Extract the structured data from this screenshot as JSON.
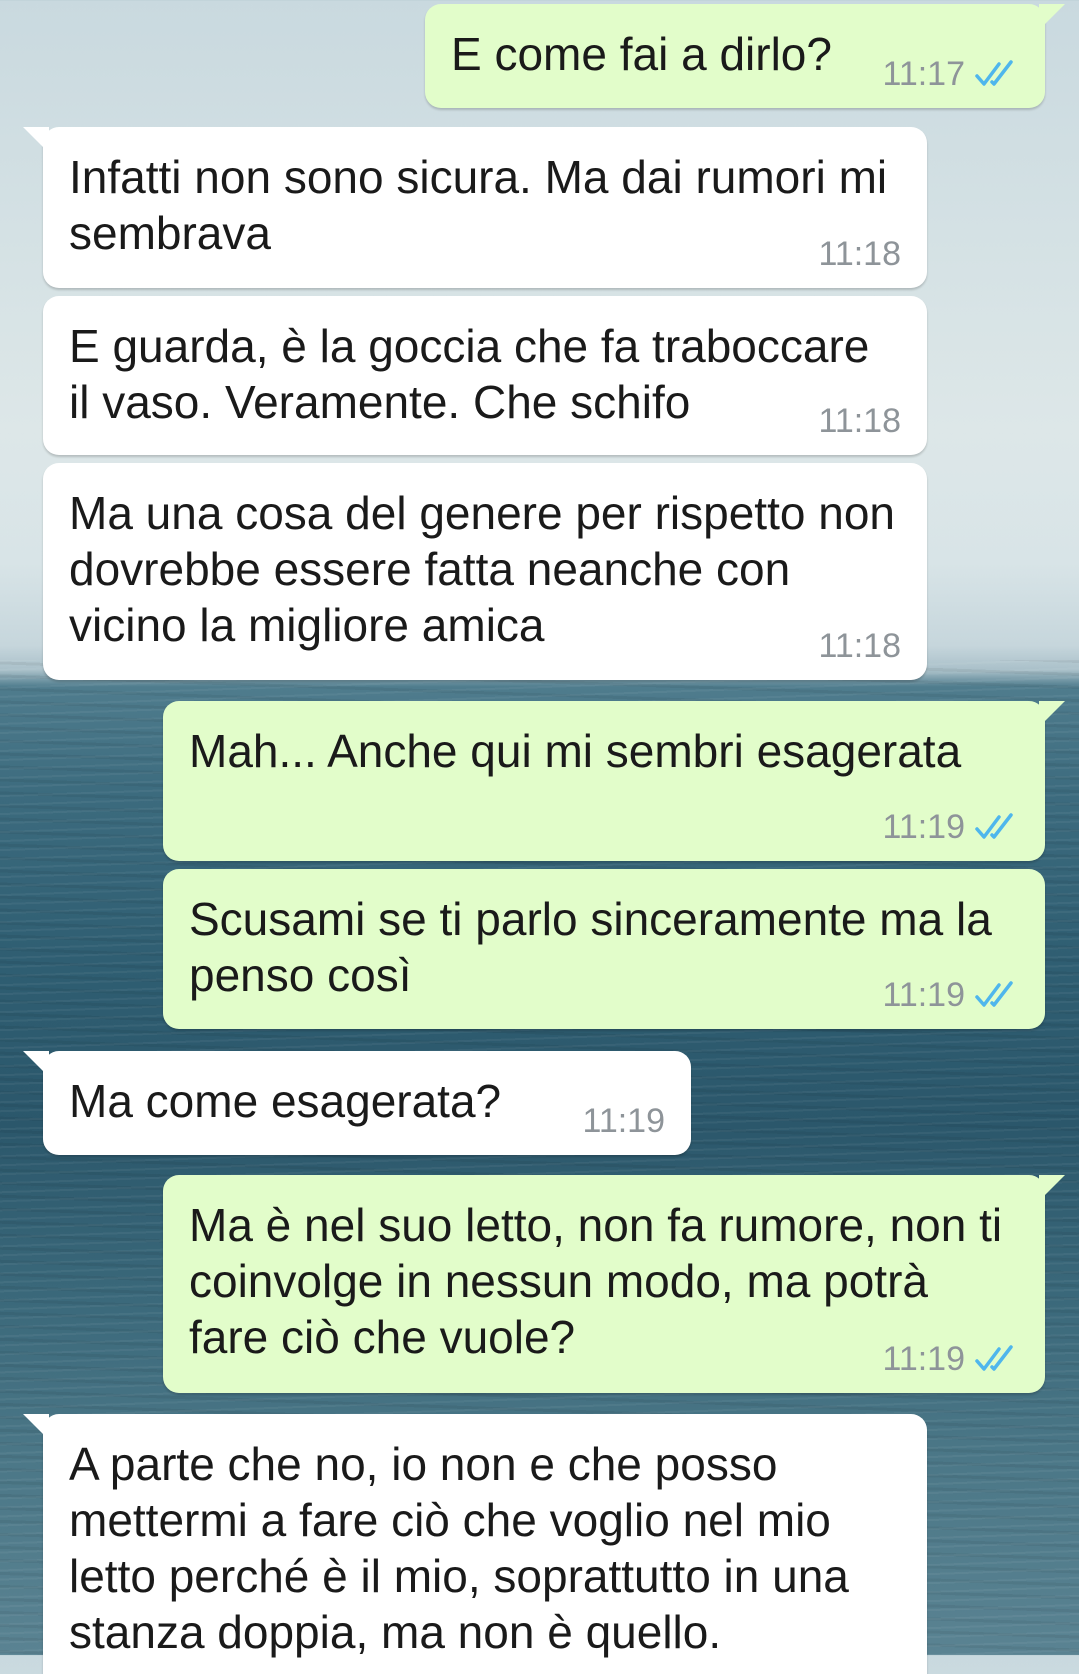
{
  "chat": {
    "messages": [
      {
        "direction": "out",
        "text": "E come fai a dirlo?",
        "time": "11:17",
        "ticks": "double-check-read-icon"
      },
      {
        "direction": "in",
        "text": "Infatti non sono sicura. Ma dai rumori mi sembrava",
        "time": "11:18"
      },
      {
        "direction": "in",
        "text": "E guarda, è la goccia che fa traboccare il vaso. Veramente. Che schifo",
        "time": "11:18"
      },
      {
        "direction": "in",
        "text": "Ma una cosa del genere per rispetto non dovrebbe essere fatta neanche con vicino la migliore amica",
        "time": "11:18"
      },
      {
        "direction": "out",
        "text": "Mah... Anche qui mi sembri esagerata",
        "time": "11:19",
        "ticks": "double-check-read-icon"
      },
      {
        "direction": "out",
        "text": "Scusami se ti parlo sinceramente ma la penso così",
        "time": "11:19",
        "ticks": "double-check-read-icon"
      },
      {
        "direction": "in",
        "text": "Ma come esagerata?",
        "time": "11:19"
      },
      {
        "direction": "out",
        "text": "Ma è nel suo letto, non fa rumore, non ti coinvolge in nessun modo, ma potrà fare ciò che vuole?",
        "time": "11:19",
        "ticks": "double-check-read-icon"
      },
      {
        "direction": "in",
        "text": "A parte che no, io non e che posso mettermi a fare ciò che voglio nel mio letto perché è il mio, soprattutto in una stanza doppia, ma non è quello.",
        "time": ""
      }
    ],
    "colors": {
      "incoming_bubble": "#ffffff",
      "outgoing_bubble": "#e2fdca",
      "read_ticks": "#4fb6ec",
      "timestamp": "#8e9499"
    }
  }
}
